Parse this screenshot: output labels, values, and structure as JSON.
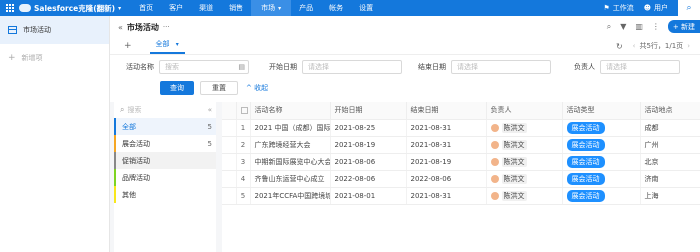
{
  "topbar": {
    "app_name": "Salesforce克隆(翻新)",
    "nav": [
      {
        "label": "首页"
      },
      {
        "label": "客户"
      },
      {
        "label": "渠道"
      },
      {
        "label": "销售"
      },
      {
        "label": "市场",
        "active": true
      },
      {
        "label": "产品"
      },
      {
        "label": "帐务"
      },
      {
        "label": "设置"
      }
    ],
    "workbench_label": "工作流",
    "user_label": "用户"
  },
  "sidebar": {
    "items": [
      {
        "label": "市场活动",
        "active": true
      }
    ],
    "add_label": "新增项"
  },
  "header": {
    "title": "市场活动",
    "more": "···",
    "new_button": "+ 新建"
  },
  "tabs": {
    "items": [
      {
        "label": "全部"
      }
    ],
    "pager": "共5行，1/1页"
  },
  "filters": [
    {
      "label": "活动名称",
      "placeholder": "搜索"
    },
    {
      "label": "开始日期",
      "placeholder": "请选择"
    },
    {
      "label": "结束日期",
      "placeholder": "请选择"
    },
    {
      "label": "负责人",
      "placeholder": "请选择"
    }
  ],
  "buttons": {
    "query": "查询",
    "reset": "重置",
    "collapse": "^ 收起"
  },
  "left_panel": {
    "search_placeholder": "搜索",
    "items": [
      {
        "label": "全部",
        "count": "5",
        "color": "#1478dc"
      },
      {
        "label": "展会活动",
        "count": "5",
        "color": "#f5a623"
      },
      {
        "label": "促销活动",
        "count": "",
        "color": "#888888"
      },
      {
        "label": "品牌活动",
        "count": "",
        "color": "#7ed321"
      },
      {
        "label": "其他",
        "count": "",
        "color": "#f8e71c"
      }
    ]
  },
  "table": {
    "columns": [
      "",
      "",
      "活动名称",
      "开始日期",
      "结束日期",
      "负责人",
      "活动类型",
      "活动地点"
    ],
    "rows": [
      {
        "idx": "1",
        "name": "2021 中国（成都）国际智慧",
        "start": "2021-08-25",
        "end": "2021-08-31",
        "owner": "陈洪文",
        "type": "展会活动",
        "place": "成都"
      },
      {
        "idx": "2",
        "name": "广东跨境经营大会",
        "start": "2021-08-19",
        "end": "2021-08-31",
        "owner": "陈洪文",
        "type": "展会活动",
        "place": "广州"
      },
      {
        "idx": "3",
        "name": "中期新国际展览中心大会",
        "start": "2021-08-06",
        "end": "2021-08-19",
        "owner": "陈洪文",
        "type": "展会活动",
        "place": "北京"
      },
      {
        "idx": "4",
        "name": "齐鲁山东运营中心成立",
        "start": "2022-08-06",
        "end": "2022-08-06",
        "owner": "陈洪文",
        "type": "展会活动",
        "place": "济南"
      },
      {
        "idx": "5",
        "name": "2021年CCFA中国跨境城镇",
        "start": "2021-08-01",
        "end": "2021-08-31",
        "owner": "陈洪文",
        "type": "展会活动",
        "place": "上海"
      }
    ]
  }
}
